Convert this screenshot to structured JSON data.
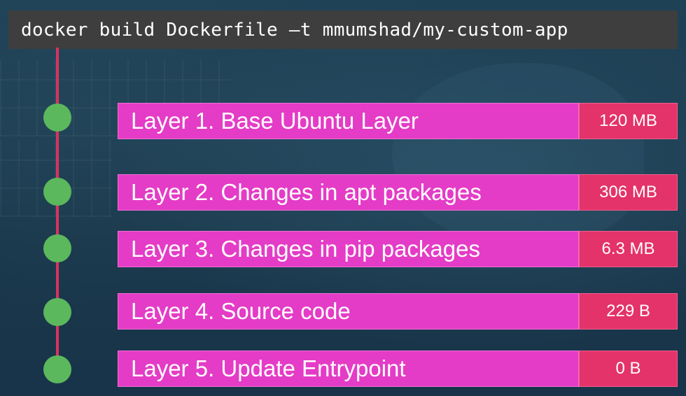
{
  "command": "docker build Dockerfile –t mmumshad/my-custom-app",
  "layers": [
    {
      "label": "Layer 1. Base Ubuntu Layer",
      "size": "120 MB"
    },
    {
      "label": "Layer 2. Changes in apt packages",
      "size": "306 MB"
    },
    {
      "label": "Layer 3. Changes in pip packages",
      "size": "6.3 MB"
    },
    {
      "label": "Layer 4. Source code",
      "size": "229 B"
    },
    {
      "label": "Layer 5. Update Entrypoint",
      "size": "0 B"
    }
  ],
  "colors": {
    "background": "#1c3a4e",
    "command_bar": "#3e3e3e",
    "timeline": "#d8335e",
    "node": "#5cb85c",
    "layer_label": "#e43cc6",
    "layer_size": "#e4326a"
  }
}
